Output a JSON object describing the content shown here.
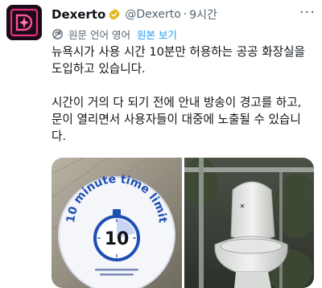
{
  "author": {
    "name": "Dexerto",
    "handle": "@Dexerto",
    "separator": "·",
    "time": "9시간",
    "avatar_icon": "dexerto-logo-icon",
    "verified_icon": "verified-gold-badge-icon",
    "more_icon": "more-options-icon",
    "more_glyph": "···"
  },
  "translation": {
    "icon": "translate-icon",
    "label": "원문 언어 영어",
    "show_original": "원본 보기"
  },
  "tweet": {
    "line1": "뉴욕시가 사용 시간 10분만 허용하는 공공 화장실을",
    "line2": "도입하고 있습니다.",
    "line3": "시간이 거의 다 되기 전에 안내 방송이 경고를 하고,",
    "line4": "문이 열리면서 사용자들이 대중에 노출될 수 있습니",
    "line5": "다."
  },
  "media": {
    "left": {
      "sign_text": "10 minute time limit",
      "timer_number": "10"
    },
    "right": {
      "subject": "toilet-photo"
    }
  },
  "colors": {
    "link": "#1d9bf0",
    "secondary_text": "#536471",
    "primary_text": "#0f1419",
    "sign_blue": "#1f4fb4",
    "avatar_bg": "#1b0b16",
    "avatar_accent": "#e7317c"
  }
}
